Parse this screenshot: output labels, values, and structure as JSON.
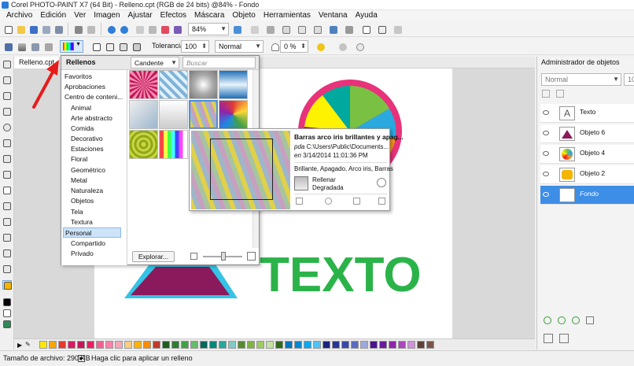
{
  "window": {
    "title": "Corel PHOTO-PAINT X7 (64 Bit) - Relleno.cpt (RGB de 24 bits) @84% - Fondo"
  },
  "menu": [
    "Archivo",
    "Edición",
    "Ver",
    "Imagen",
    "Ajustar",
    "Efectos",
    "Máscara",
    "Objeto",
    "Herramientas",
    "Ventana",
    "Ayuda"
  ],
  "toolbar": {
    "zoom": "84%"
  },
  "property_bar": {
    "tolerance_label": "Tolerancia:",
    "tolerance_value": "100",
    "mode": "Normal",
    "transparency": "0 %"
  },
  "document": {
    "tab": "Relleno.cpt"
  },
  "picker": {
    "title": "Rellenos",
    "filter": "Candente",
    "search_placeholder": "Buscar",
    "categories": [
      {
        "label": "Favoritos",
        "indent": false
      },
      {
        "label": "Aprobaciones",
        "indent": false
      },
      {
        "label": "Centro de conteni...",
        "indent": false
      },
      {
        "label": "Animal",
        "indent": true
      },
      {
        "label": "Arte abstracto",
        "indent": true
      },
      {
        "label": "Comida",
        "indent": true
      },
      {
        "label": "Decorativo",
        "indent": true
      },
      {
        "label": "Estaciones",
        "indent": true
      },
      {
        "label": "Floral",
        "indent": true
      },
      {
        "label": "Geométrico",
        "indent": true
      },
      {
        "label": "Metal",
        "indent": true
      },
      {
        "label": "Naturaleza",
        "indent": true
      },
      {
        "label": "Objetos",
        "indent": true
      },
      {
        "label": "Tela",
        "indent": true
      },
      {
        "label": "Textura",
        "indent": true
      },
      {
        "label": "Personal",
        "indent": false,
        "selected": true
      },
      {
        "label": "Compartido",
        "indent": true
      },
      {
        "label": "Privado",
        "indent": true
      }
    ],
    "explore_button": "Explorar..."
  },
  "tooltip": {
    "title": "Barras arco iris brillantes y apag...",
    "path_prefix": "pda",
    "path": "C:\\Users\\Public\\Documents...",
    "date_prefix": "en",
    "date": "3/14/2014 11:01:36 PM",
    "tags": "Brillante, Apagado, Arco iris, Barras",
    "fill_line1": "Rellenar",
    "fill_line2": "Degradada"
  },
  "canvas_text": "TEXTO",
  "objects_panel": {
    "title": "Administrador de objetos",
    "mode": "Normal",
    "opacity": "100",
    "objects": [
      {
        "name": "Texto",
        "selected": false
      },
      {
        "name": "Objeto 6",
        "selected": false
      },
      {
        "name": "Objeto 4",
        "selected": false
      },
      {
        "name": "Objeto 2",
        "selected": false
      },
      {
        "name": "Fondo",
        "selected": true
      }
    ]
  },
  "palette": [
    "#ffe800",
    "#f7a600",
    "#e8382d",
    "#d81b60",
    "#c2185b",
    "#e91e63",
    "#f06292",
    "#ff80ab",
    "#f4a7b9",
    "#ffcc80",
    "#ffb300",
    "#fb8c00",
    "#c0392b",
    "#1b5e20",
    "#2e7d32",
    "#43a047",
    "#66bb6a",
    "#00695c",
    "#00897b",
    "#26a69a",
    "#80cbc4",
    "#558b2f",
    "#7cb342",
    "#9ccc65",
    "#c5e1a5",
    "#33691e",
    "#0277bd",
    "#0288d1",
    "#03a9f4",
    "#4fc3f7",
    "#1a237e",
    "#283593",
    "#3949ab",
    "#5c6bc0",
    "#9fa8da",
    "#4a148c",
    "#6a1b9a",
    "#8e24aa",
    "#ab47bc",
    "#ce93d8",
    "#5d4037",
    "#795548"
  ],
  "status": {
    "file_size": "Tamaño de archivo: 290 KB",
    "hint": "Haga clic para aplicar un relleno"
  }
}
